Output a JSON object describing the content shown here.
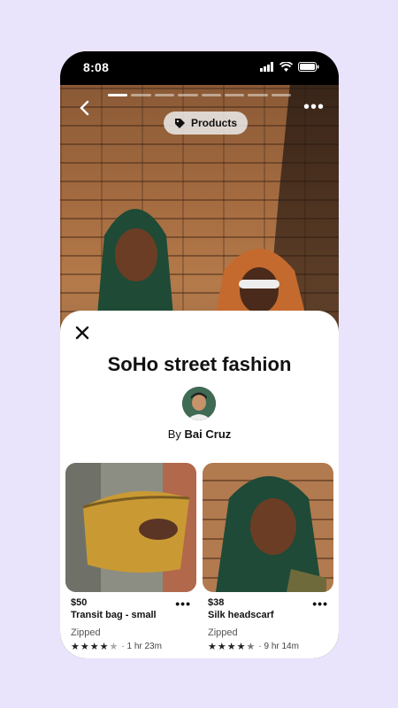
{
  "status": {
    "time": "8:08"
  },
  "story": {
    "pill_label": "Products",
    "progress_segments": 8,
    "active_segment": 1
  },
  "sheet": {
    "title": "SoHo street fashion",
    "by_prefix": "By",
    "author": "Bai Cruz"
  },
  "products": [
    {
      "price": "$50",
      "name": "Transit bag - small",
      "brand": "Zipped",
      "rating": 4,
      "duration": "· 1 hr 23m"
    },
    {
      "price": "$38",
      "name": "Silk headscarf",
      "brand": "Zipped",
      "rating": 4.5,
      "duration": "· 9 hr 14m"
    }
  ],
  "colors": {
    "background": "#e9e3fb",
    "accent": "#111111"
  }
}
